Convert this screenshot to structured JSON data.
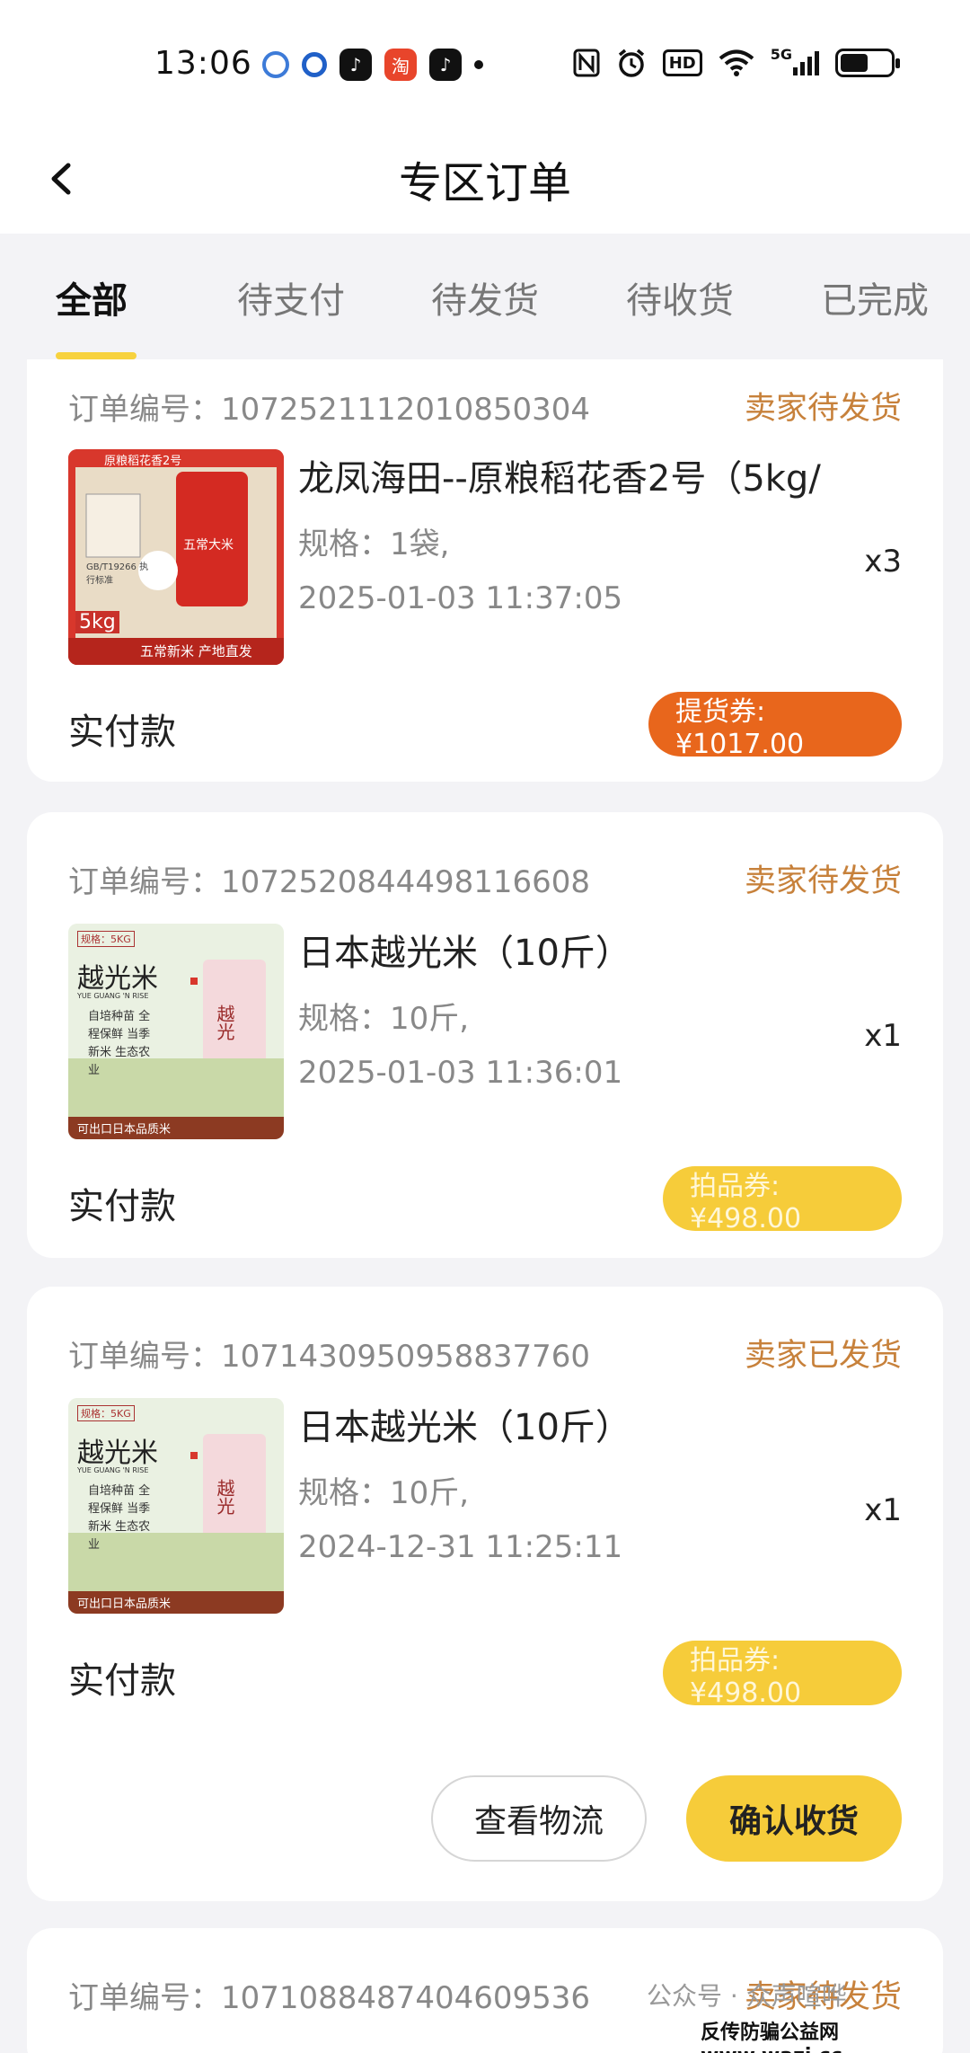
{
  "status_bar": {
    "time": "13:06",
    "apps": [
      {
        "icon": "circle-app-icon",
        "color": "#3d7bd8"
      },
      {
        "icon": "ring-app-icon",
        "color": "#2060c8"
      },
      {
        "icon": "tiktok-icon",
        "color": "#111111"
      },
      {
        "icon": "taobao-icon",
        "color": "#e8452b",
        "label": "淘"
      },
      {
        "icon": "tiktok-mall-icon",
        "color": "#111111"
      }
    ],
    "right_icons": [
      "nfc-icon",
      "alarm-icon",
      "hd-icon",
      "wifi-icon",
      "signal-5g-icon"
    ],
    "hd_label": "HD",
    "net_label": "5G",
    "battery_level": 0.55
  },
  "nav": {
    "title": "专区订单"
  },
  "tabs": [
    {
      "label": "全部",
      "active": true
    },
    {
      "label": "待支付",
      "active": false
    },
    {
      "label": "待发货",
      "active": false
    },
    {
      "label": "待收货",
      "active": false
    },
    {
      "label": "已完成",
      "active": false
    }
  ],
  "orders": [
    {
      "order_no": "订单编号：1072521112010850304",
      "status": "卖家待发货",
      "product": "龙凤海田--原粮稻花香2号（5kg/",
      "spec": "规格：1袋,",
      "date": "2025-01-03 11:37:05",
      "qty": "x3",
      "paid_label": "实付款",
      "price": "提货券:¥1017.00",
      "thumb": {
        "top_text": "原粮稻花香2号",
        "bag_text": "五常大米",
        "weight": "5kg",
        "footer": "五常新米 产地直发",
        "std": "GB/T19266 执行标准"
      }
    },
    {
      "order_no": "订单编号：1072520844498116608",
      "status": "卖家待发货",
      "product": "日本越光米（10斤）",
      "spec": "规格：10斤,",
      "date": "2025-01-03 11:36:01",
      "qty": "x1",
      "paid_label": "实付款",
      "price": "拍品券:¥498.00",
      "thumb": {
        "tag": "规格：5KG",
        "brand": "越光米",
        "en": "YUE GUANG 'N RISE",
        "lines": "自培种苗 全程保鲜 当季新米 生态农业",
        "footer": "可出口日本品质米",
        "bag": "越光"
      }
    },
    {
      "order_no": "订单编号：1071430950958837760",
      "status": "卖家已发货",
      "product": "日本越光米（10斤）",
      "spec": "规格：10斤,",
      "date": "2024-12-31 11:25:11",
      "qty": "x1",
      "paid_label": "实付款",
      "price": "拍品券:¥498.00",
      "actions": {
        "logistics": "查看物流",
        "confirm": "确认收货"
      },
      "thumb": {
        "tag": "规格：5KG",
        "brand": "越光米",
        "en": "YUE GUANG 'N RISE",
        "lines": "自培种苗 全程保鲜 当季新米 生态农业",
        "footer": "可出口日本品质米",
        "bag": "越光"
      }
    },
    {
      "order_no": "订单编号：1071088487404609536",
      "status": "卖家待发货"
    }
  ],
  "watermark": {
    "line1": "公众号 · 众声喧哗",
    "line2": "反传防骗公益网 www.wazi.cc"
  }
}
